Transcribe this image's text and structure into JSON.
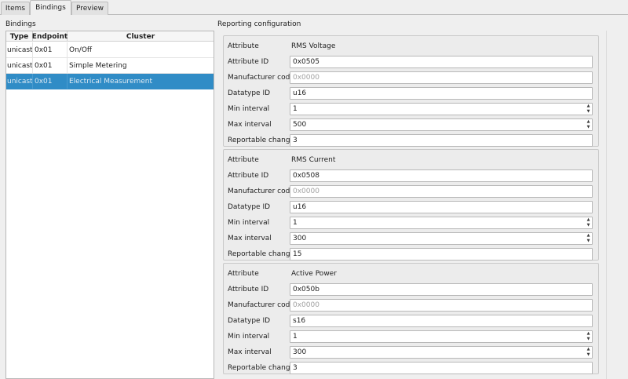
{
  "tabs": [
    {
      "label": "Items",
      "active": false
    },
    {
      "label": "Bindings",
      "active": true
    },
    {
      "label": "Preview",
      "active": false
    }
  ],
  "bindings": {
    "title": "Bindings",
    "columns": [
      "Type",
      "Endpoint",
      "Cluster"
    ],
    "rows": [
      {
        "type": "unicast",
        "endpoint": "0x01",
        "cluster": "On/Off",
        "selected": false
      },
      {
        "type": "unicast",
        "endpoint": "0x01",
        "cluster": "Simple Metering",
        "selected": false
      },
      {
        "type": "unicast",
        "endpoint": "0x01",
        "cluster": "Electrical Measurement",
        "selected": true
      }
    ],
    "selection_color": "#308cc6"
  },
  "reporting": {
    "title": "Reporting configuration",
    "labels": {
      "attribute": "Attribute",
      "attribute_id": "Attribute ID",
      "manufacturer_code": "Manufacturer code",
      "datatype_id": "Datatype ID",
      "min_interval": "Min interval",
      "max_interval": "Max interval",
      "reportable_change": "Reportable change"
    },
    "manufacturer_placeholder": "0x0000",
    "attributes": [
      {
        "name": "RMS Voltage",
        "attribute_id": "0x0505",
        "manufacturer_code": "",
        "datatype_id": "u16",
        "min_interval": "1",
        "max_interval": "500",
        "reportable_change": "3"
      },
      {
        "name": "RMS Current",
        "attribute_id": "0x0508",
        "manufacturer_code": "",
        "datatype_id": "u16",
        "min_interval": "1",
        "max_interval": "300",
        "reportable_change": "15"
      },
      {
        "name": "Active Power",
        "attribute_id": "0x050b",
        "manufacturer_code": "",
        "datatype_id": "s16",
        "min_interval": "1",
        "max_interval": "300",
        "reportable_change": "3"
      }
    ]
  },
  "icons": {
    "spin_up": "spin-up-icon",
    "spin_down": "spin-down-icon"
  }
}
